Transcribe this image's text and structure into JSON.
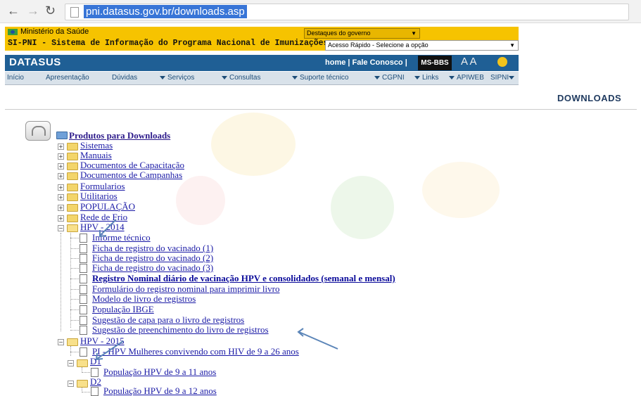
{
  "browser": {
    "url": "pni.datasus.gov.br/downloads.asp",
    "back_icon": "back-arrow-icon",
    "forward_icon": "forward-arrow-icon",
    "reload_icon": "reload-icon"
  },
  "gov_bar": {
    "ministerio": "Ministério da Saúde",
    "system_title": "SI-PNI - Sistema de Informação do Programa Nacional de Imunizações",
    "destaques": "Destaques do governo",
    "acesso_rapido": "Acesso Rápido - Selecione a opção"
  },
  "datasus_bar": {
    "logo": "DATASUS",
    "links": "home  |  Fale Conosco  |",
    "ms_bbs": "MS-BBS",
    "font_size": "A A"
  },
  "menu": [
    "Início",
    "Apresentação",
    "Dúvidas",
    "Serviços",
    "Consultas",
    "Suporte técnico",
    "CGPNI",
    "Links",
    "APIWEB",
    "SIPNI"
  ],
  "page_heading": "DOWNLOADS",
  "tree": {
    "root": "Produtos para Downloads",
    "folders": [
      "Sistemas",
      "Manuais",
      "Documentos de Capacitação",
      "Documentos de Campanhas",
      "Formularios",
      "Utilitarios",
      "POPULAÇÃO",
      "Rede de Frio"
    ],
    "hpv2014": {
      "label": "HPV - 2014",
      "items": [
        "Informe técnico",
        "Ficha de registro do vacinado (1)",
        "Ficha de registro do vacinado (2)",
        "Ficha de registro do vacinado (3)",
        "Registro Nominal diário de vacinação HPV e consolidados (semanal e mensal)",
        "Formulário do registro nominal para imprimir livro",
        "Modelo de livro de registros",
        "População IBGE",
        "Sugestão de capa para o livro de registros",
        "Sugestão de preenchimento do livro de registros"
      ]
    },
    "hpv2015": {
      "label": "HPV - 2015",
      "item": "PI - HPV Mulheres convivendo com HIV de 9 a 26 anos",
      "d1": {
        "label": "D1",
        "item": "População HPV de 9 a 11 anos"
      },
      "d2": {
        "label": "D2",
        "item": "População HPV de 9 a 12 anos"
      }
    }
  },
  "colors": {
    "gov_yellow": "#f6c300",
    "datasus_blue": "#1f5f95",
    "link": "#1a1aa6",
    "annotation_arrow": "#5b85b8"
  }
}
